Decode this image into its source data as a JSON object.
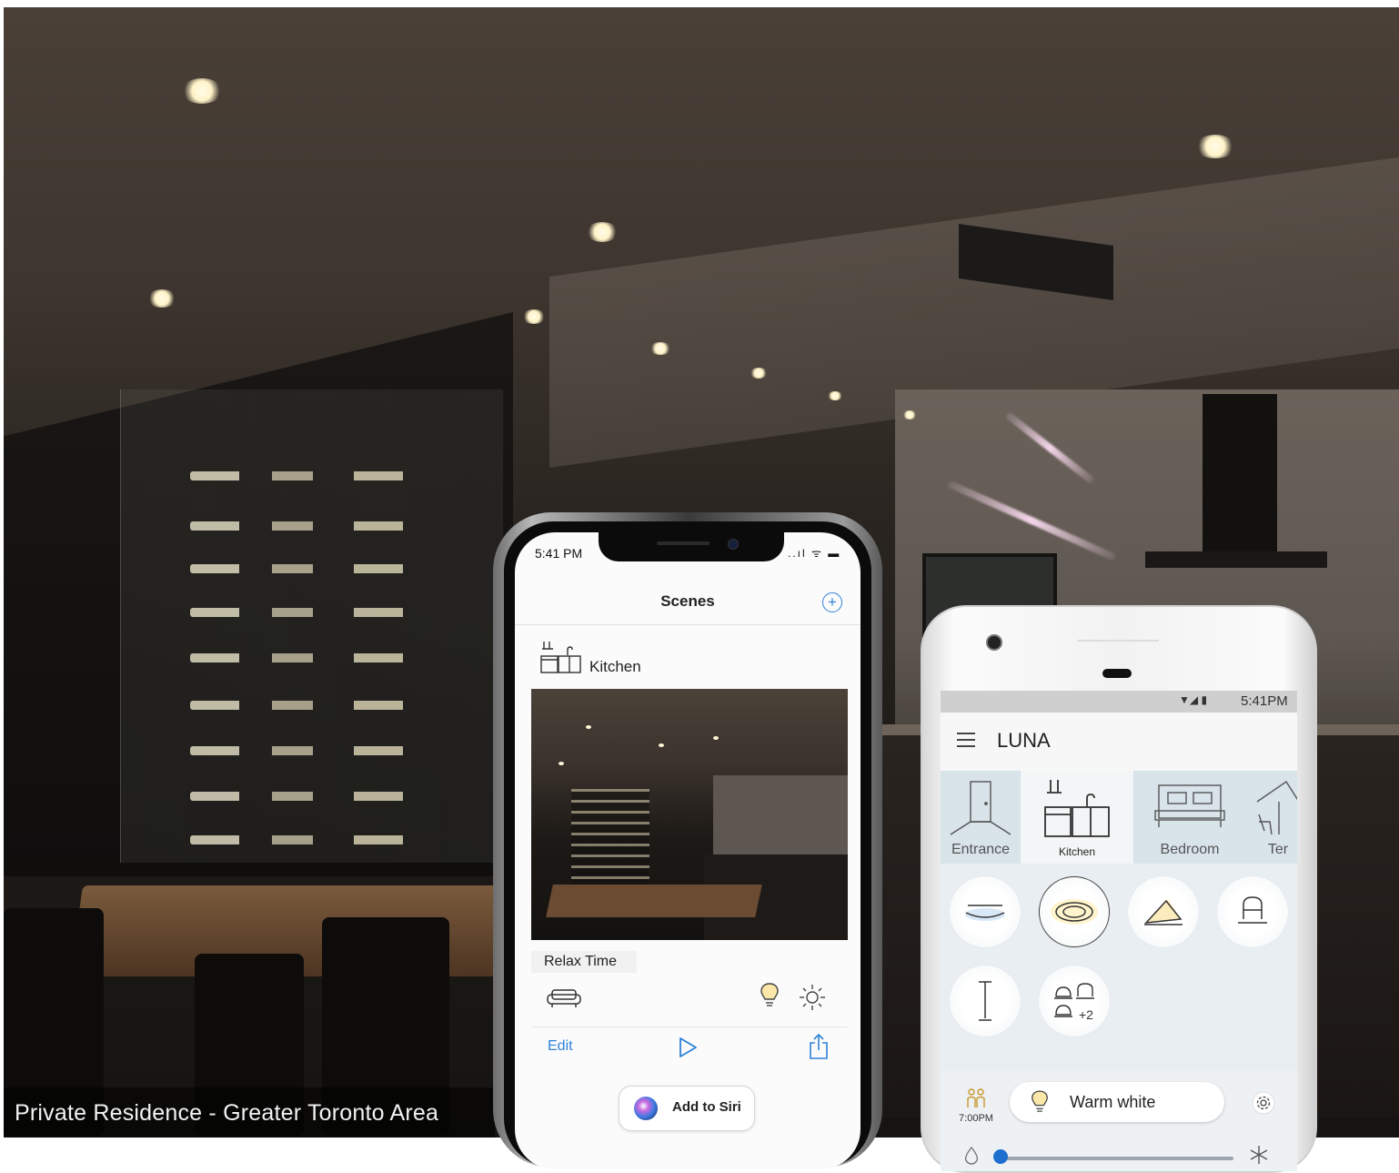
{
  "caption": {
    "text": "Private Residence - Greater Toronto Area"
  },
  "iphone": {
    "time": "5:41 PM",
    "status": "..ıl ᯤ ▬",
    "title": "Scenes",
    "add_icon": "plus-circle-icon",
    "room": {
      "label": "Kitchen",
      "icon": "kitchen-icon"
    },
    "scene": {
      "name": "Relax Time",
      "icons": [
        "sofa-icon",
        "lightbulb-icon",
        "sun-icon"
      ]
    },
    "actions": {
      "edit": "Edit",
      "play_icon": "play-icon",
      "share_icon": "share-icon"
    },
    "siri": {
      "label": "Add to Siri"
    },
    "accent_color": "#2f82d8"
  },
  "android": {
    "status_icons": "▼◢ ▮",
    "time": "5:41PM",
    "title": "LUNA",
    "rooms": [
      {
        "label": "Entrance",
        "icon": "door-icon"
      },
      {
        "label": "Kitchen",
        "icon": "kitchen-icon",
        "active": true
      },
      {
        "label": "Bedroom",
        "icon": "bed-icon"
      },
      {
        "label": "Ter",
        "icon": "terrace-icon"
      }
    ],
    "fixtures": [
      {
        "icon": "ceiling-disc-light-icon"
      },
      {
        "icon": "recessed-light-icon",
        "selected": true
      },
      {
        "icon": "panel-light-icon"
      },
      {
        "icon": "wall-sconce-icon"
      },
      {
        "icon": "floor-lamp-icon"
      },
      {
        "icon": "fixture-group-icon",
        "extra": "+2"
      }
    ],
    "schedule_time": "7:00PM",
    "mode_label": "Warm white",
    "slider_level": 0.03,
    "brand_color": "#1d6fcf"
  }
}
